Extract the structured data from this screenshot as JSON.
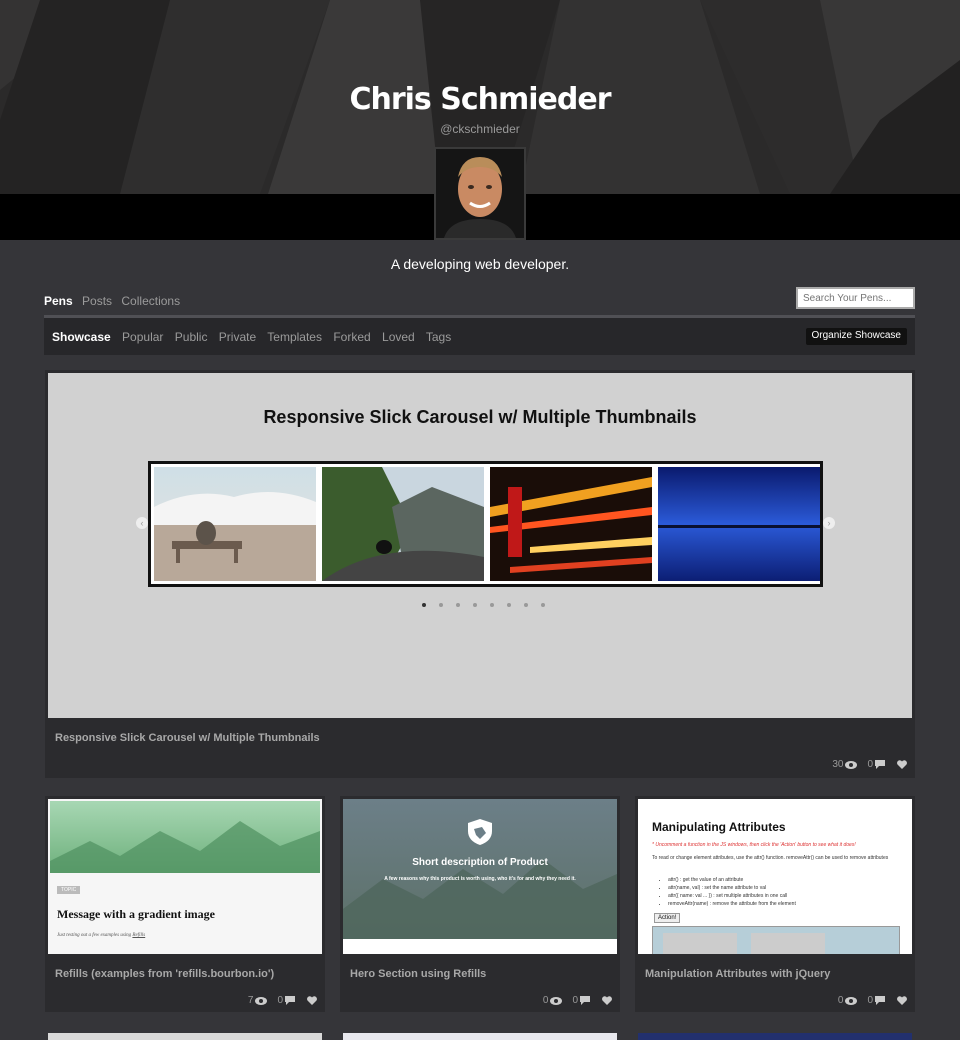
{
  "profile": {
    "name": "Chris Schmieder",
    "handle": "@ckschmieder",
    "bio": "A developing web developer."
  },
  "tabs": [
    "Pens",
    "Posts",
    "Collections"
  ],
  "search": {
    "placeholder": "Search Your Pens..."
  },
  "subnav": {
    "items": [
      "Showcase",
      "Popular",
      "Public",
      "Private",
      "Templates",
      "Forked",
      "Loved",
      "Tags"
    ],
    "organize_label": "Organize Showcase"
  },
  "showcase": {
    "preview_heading": "Responsive Slick Carousel w/ Multiple Thumbnails",
    "title": "Responsive Slick Carousel w/ Multiple Thumbnails",
    "views": "30",
    "comments": "0"
  },
  "cards": [
    {
      "title": "Refills (examples from 'refills.bourbon.io')",
      "views": "7",
      "comments": "0",
      "preview": {
        "tag": "TOPIC",
        "heading": "Message with a gradient image",
        "note": "Just testing out a few examples using",
        "link": "Refills"
      }
    },
    {
      "title": "Hero Section using Refills",
      "views": "0",
      "comments": "0",
      "preview": {
        "heading": "Short description of Product",
        "sub": "A few reasons why this product is worth using, who it's for and why they need it."
      }
    },
    {
      "title": "Manipulation Attributes with jQuery",
      "views": "0",
      "comments": "0",
      "preview": {
        "heading": "Manipulating Attributes",
        "note": "* Uncomment a function in the JS windows, then click the 'Action' button to see what it does!",
        "intro": "To read or change element attributes, use the attr() function. removeAttr() can be used to remove attributes",
        "bullets": [
          "attr() : get the value of an attribute",
          "attr(name, val) : set the name attribute to val",
          "attr({ name: val ... }) : set multiple attributes in one call",
          "removeAttr(name) : remove the attribute from the element"
        ],
        "button": "Action!"
      }
    }
  ]
}
